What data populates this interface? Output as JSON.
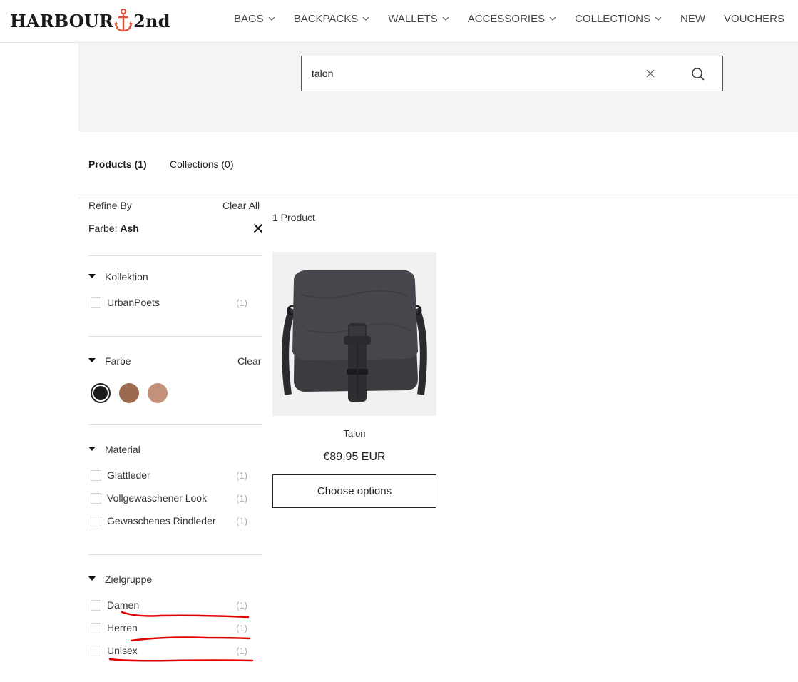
{
  "header": {
    "logo_left": "HARBOUR",
    "logo_right": "2nd",
    "nav": [
      {
        "label": "BAGS",
        "has_dropdown": true
      },
      {
        "label": "BACKPACKS",
        "has_dropdown": true
      },
      {
        "label": "WALLETS",
        "has_dropdown": true
      },
      {
        "label": "ACCESSORIES",
        "has_dropdown": true
      },
      {
        "label": "COLLECTIONS",
        "has_dropdown": true
      },
      {
        "label": "NEW",
        "has_dropdown": false
      },
      {
        "label": "VOUCHERS",
        "has_dropdown": false
      }
    ]
  },
  "search": {
    "value": "talon",
    "clear_icon": "close-icon",
    "submit_icon": "search-icon"
  },
  "tabs": {
    "products": "Products (1)",
    "collections": "Collections (0)"
  },
  "sidebar": {
    "refine_title": "Refine By",
    "clear_all": "Clear All",
    "active_filter_key": "Farbe:",
    "active_filter_value": "Ash",
    "facets": {
      "kollektion": {
        "title": "Kollektion",
        "options": [
          {
            "label": "UrbanPoets",
            "count": "(1)"
          }
        ]
      },
      "farbe": {
        "title": "Farbe",
        "clear": "Clear",
        "swatches": [
          {
            "name": "Ash",
            "color": "#1b1b1b",
            "selected": true
          },
          {
            "name": "Brown",
            "color": "#9c6a4e",
            "selected": false
          },
          {
            "name": "Rose",
            "color": "#c3907a",
            "selected": false
          }
        ]
      },
      "material": {
        "title": "Material",
        "options": [
          {
            "label": "Glattleder",
            "count": "(1)"
          },
          {
            "label": "Vollgewaschener Look",
            "count": "(1)"
          },
          {
            "label": "Gewaschenes Rindleder",
            "count": "(1)"
          }
        ]
      },
      "zielgruppe": {
        "title": "Zielgruppe",
        "options": [
          {
            "label": "Damen",
            "count": "(1)"
          },
          {
            "label": "Herren",
            "count": "(1)"
          },
          {
            "label": "Unisex",
            "count": "(1)"
          }
        ]
      }
    }
  },
  "results": {
    "count_label": "1 Product",
    "products": [
      {
        "title": "Talon",
        "price": "€89,95 EUR",
        "button": "Choose options"
      }
    ]
  },
  "colors": {
    "annotation_red": "#e00000",
    "logo_anchor": "#e0523a"
  }
}
